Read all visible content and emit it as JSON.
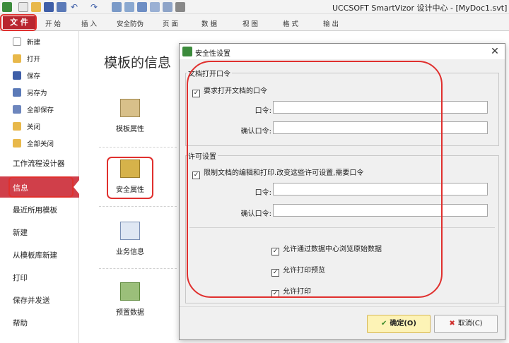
{
  "titlebar": {
    "app_title": "UCCSOFT SmartVizor 设计中心 - [MyDoc1.svt]"
  },
  "menu": {
    "file": "文 件",
    "tabs": [
      "开 始",
      "插 入",
      "安全防伪",
      "页 面",
      "数 据",
      "视 图",
      "格 式",
      "输 出"
    ]
  },
  "leftnav": {
    "small_items": [
      "新建",
      "打开",
      "保存",
      "另存为",
      "全部保存",
      "关闭",
      "全部关闭"
    ],
    "big_items": [
      "工作流程设计器",
      "信息",
      "最近所用模板",
      "新建",
      "从模板库新建",
      "打印",
      "保存并发送",
      "帮助"
    ]
  },
  "main": {
    "heading": "模板的信息",
    "props": [
      "模板属性",
      "安全属性",
      "业务信息",
      "预置数据"
    ]
  },
  "dialog": {
    "title": "安全性设置",
    "close": "✕",
    "group1_title": "文档打开口令",
    "require_open_password": "要求打开文档的口令",
    "password_label": "口令:",
    "confirm_password_label": "确认口令:",
    "group2_title": "许可设置",
    "restrict_edit_print": "限制文档的编辑和打印.改变这些许可设置,需要口令",
    "allow_browse_raw": "允许通过数据中心浏览原始数据",
    "allow_print_preview": "允许打印预览",
    "allow_print": "允许打印",
    "ok": "确定(O)",
    "cancel": "取消(C)"
  },
  "colors": {
    "accent_red": "#b9262f",
    "highlight_red": "#e0302e",
    "nav_selected": "#d03f4a"
  }
}
